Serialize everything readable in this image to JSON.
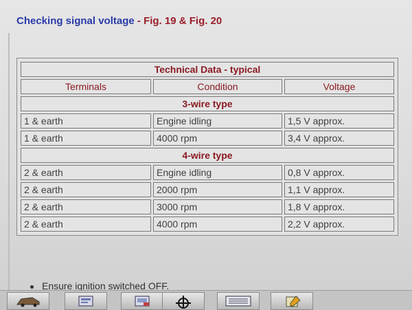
{
  "header": {
    "title_main": "Checking signal voltage",
    "separator": " - ",
    "title_figs": "Fig. 19 & Fig. 20"
  },
  "table": {
    "caption": "Technical Data - typical",
    "columns": [
      "Terminals",
      "Condition",
      "Voltage"
    ],
    "sections": [
      {
        "title": "3-wire type",
        "rows": [
          [
            "1 & earth",
            "Engine idling",
            "1,5 V approx."
          ],
          [
            "1 & earth",
            "4000 rpm",
            "3,4 V approx."
          ]
        ]
      },
      {
        "title": "4-wire type",
        "rows": [
          [
            "2 & earth",
            "Engine idling",
            "0,8 V approx."
          ],
          [
            "2 & earth",
            "2000 rpm",
            "1,1 V approx."
          ],
          [
            "2 & earth",
            "3000 rpm",
            "1,8 V approx."
          ],
          [
            "2 & earth",
            "4000 rpm",
            "2,2 V approx."
          ]
        ]
      }
    ]
  },
  "instructions": {
    "bullet_1": "Ensure ignition switched OFF."
  },
  "toolbar": {
    "buttons": [
      {
        "icon": "car-icon"
      },
      {
        "icon": "print-preview-icon"
      },
      {
        "icon": "print-icon"
      },
      {
        "icon": "crosshair-icon"
      },
      {
        "icon": "data-list-icon"
      },
      {
        "icon": "notes-icon"
      }
    ]
  }
}
